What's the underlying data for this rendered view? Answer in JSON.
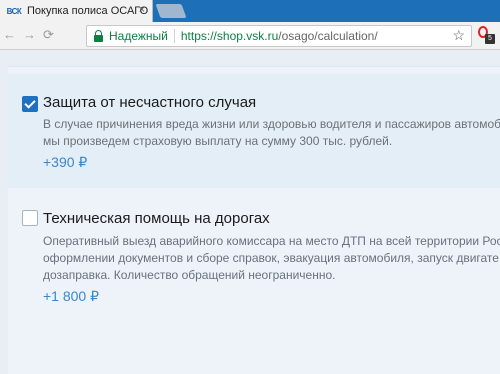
{
  "tab": {
    "favicon": "ВСК",
    "title": "Покупка полиса ОСАГО",
    "close": "×"
  },
  "toolbar": {
    "back": "←",
    "forward": "→",
    "reload": "⟳",
    "secure_label": "Надежный",
    "url_scheme": "https://",
    "url_host": "shop.vsk.ru",
    "url_path": "/osago/calculation/",
    "star": "☆",
    "extension_badge": "5"
  },
  "options": [
    {
      "checked": true,
      "title": "Защита от несчастного случая",
      "description": "В случае причинения вреда жизни или здоровью водителя и пассажиров автомоби\nмы произведем страховую выплату на сумму 300 тыс. рублей.",
      "price": "+390 ₽"
    },
    {
      "checked": false,
      "title": "Техническая помощь на дорогах",
      "description": "Оперативный выезд аварийного комиссара на место ДТП на всей территории Рос\nоформлении документов и сборе справок, эвакуация автомобиля, запуск двигате\nдозаправка. Количество обращений неограниченно.",
      "price": "+1 800 ₽"
    }
  ],
  "colors": {
    "tabstrip": "#1d6fb8",
    "secure": "#0b8043",
    "accent": "#1e70c2",
    "price": "#3d86c8"
  }
}
